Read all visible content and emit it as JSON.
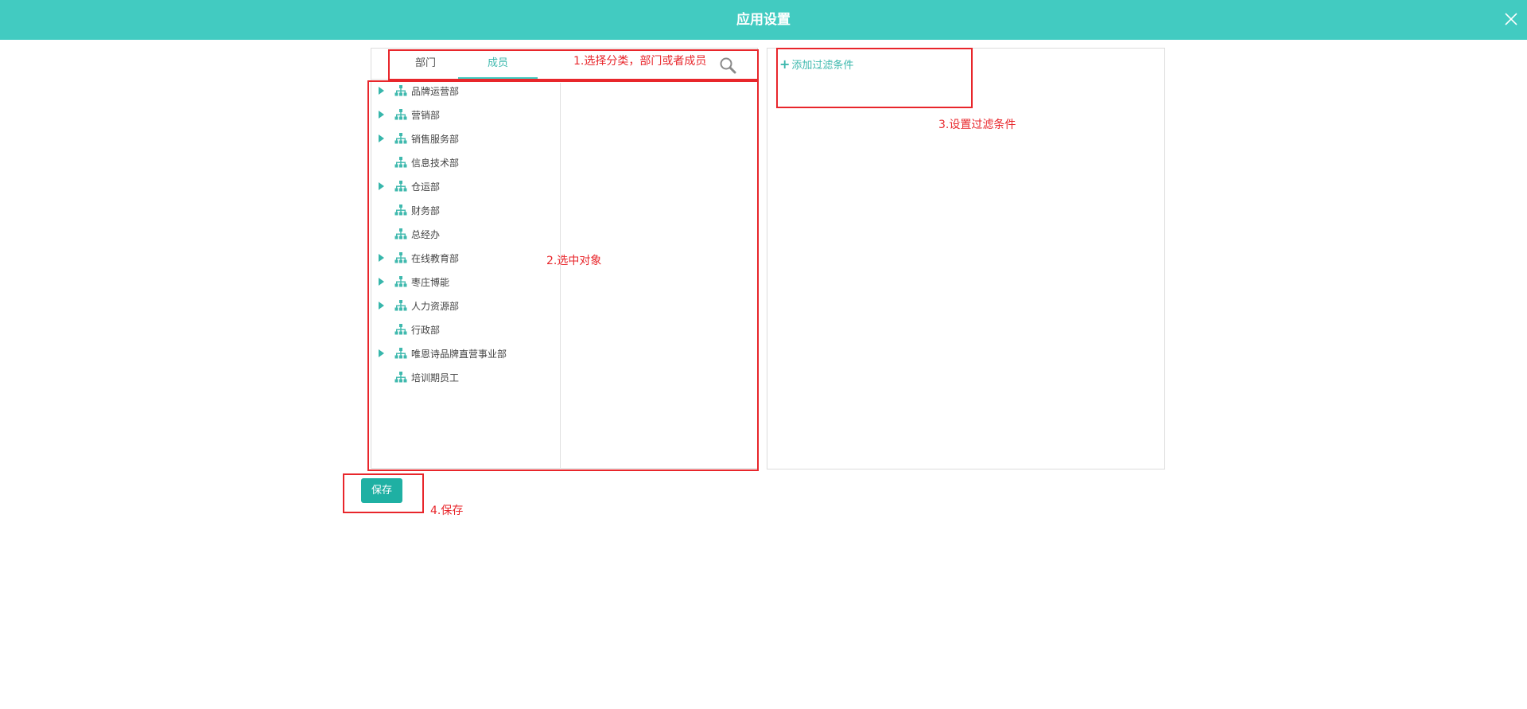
{
  "header": {
    "title": "应用设置",
    "close_icon": "close-icon"
  },
  "tabs": [
    {
      "label": "部门",
      "active": false
    },
    {
      "label": "成员",
      "active": true
    }
  ],
  "search": {
    "icon": "search-icon"
  },
  "tree": {
    "items": [
      {
        "label": "品牌运营部",
        "expandable": true
      },
      {
        "label": "营销部",
        "expandable": true
      },
      {
        "label": "销售服务部",
        "expandable": true
      },
      {
        "label": "信息技术部",
        "expandable": false
      },
      {
        "label": "仓运部",
        "expandable": true
      },
      {
        "label": "财务部",
        "expandable": false
      },
      {
        "label": "总经办",
        "expandable": false
      },
      {
        "label": "在线教育部",
        "expandable": true
      },
      {
        "label": "枣庄博能",
        "expandable": true
      },
      {
        "label": "人力资源部",
        "expandable": true
      },
      {
        "label": "行政部",
        "expandable": false
      },
      {
        "label": "唯恩诗品牌直营事业部",
        "expandable": true
      },
      {
        "label": "培训期员工",
        "expandable": false
      }
    ]
  },
  "filter": {
    "add_label": "添加过滤条件",
    "plus": "+"
  },
  "save": {
    "label": "保存"
  },
  "annotations": {
    "step1": "1.选择分类，部门或者成员",
    "step2": "2.选中对象",
    "step3": "3.设置过滤条件",
    "step4": "4.保存"
  },
  "colors": {
    "header_bg": "#42cbc1",
    "accent": "#3fb9ae",
    "save_bg": "#1fb0a3",
    "annotation": "#e8262b"
  }
}
